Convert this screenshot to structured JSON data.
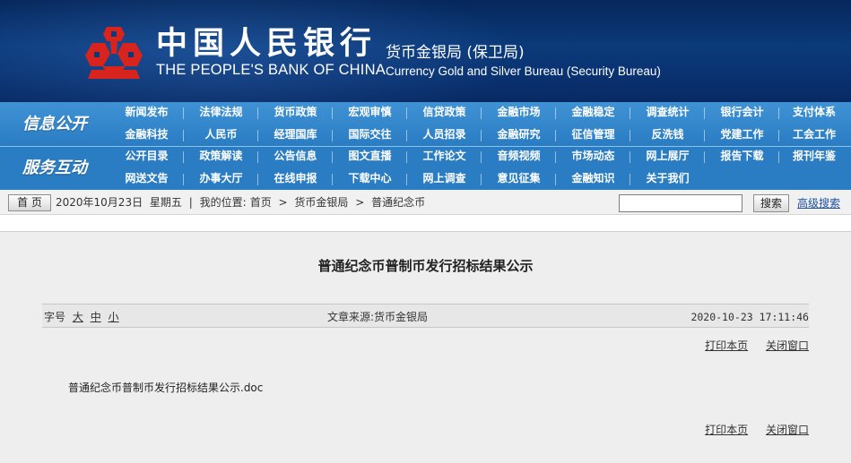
{
  "header": {
    "cn_name": "中国人民银行",
    "en_name": "THE PEOPLE'S BANK OF CHINA",
    "bureau_cn": "货币金银局 (保卫局)",
    "bureau_en": "Currency  Gold and Silver Bureau (Security Bureau)"
  },
  "nav": {
    "label_info": "信息公开",
    "label_service": "服务互动",
    "row1": [
      "新闻发布",
      "法律法规",
      "货币政策",
      "宏观审慎",
      "信贷政策",
      "金融市场",
      "金融稳定",
      "调查统计",
      "银行会计",
      "支付体系"
    ],
    "row2": [
      "金融科技",
      "人民币",
      "经理国库",
      "国际交往",
      "人员招录",
      "金融研究",
      "征信管理",
      "反洗钱",
      "党建工作",
      "工会工作"
    ],
    "row3": [
      "公开目录",
      "政策解读",
      "公告信息",
      "图文直播",
      "工作论文",
      "音频视频",
      "市场动态",
      "网上展厅",
      "报告下载",
      "报刊年鉴"
    ],
    "row4": [
      "网送文告",
      "办事大厅",
      "在线申报",
      "下载中心",
      "网上调查",
      "意见征集",
      "金融知识",
      "关于我们"
    ]
  },
  "crumb": {
    "home": "首 页",
    "date": "2020年10月23日",
    "weekday": "星期五",
    "sep1": "|",
    "location_label": "我的位置:",
    "path1": "首页",
    "arrow1": ">",
    "path2": "货币金银局",
    "arrow2": ">",
    "path3": "普通纪念币",
    "search_label": "搜索",
    "advanced_label": "高级搜索"
  },
  "article": {
    "title": "普通纪念币普制币发行招标结果公示",
    "font_label": "字号",
    "font_large": "大",
    "font_medium": "中",
    "font_small": "小",
    "source": "文章来源:货币金银局",
    "datetime": "2020-10-23 17:11:46",
    "print_label": "打印本页",
    "close_label": "关闭窗口",
    "attachment": "普通纪念币普制币发行招标结果公示.doc"
  },
  "colors": {
    "header_bg": "#0b3a7a",
    "nav_bg": "#2a7cc3",
    "logo_red": "#d9231d",
    "content_bg": "#eeeeee",
    "link_blue": "#2150a0"
  }
}
